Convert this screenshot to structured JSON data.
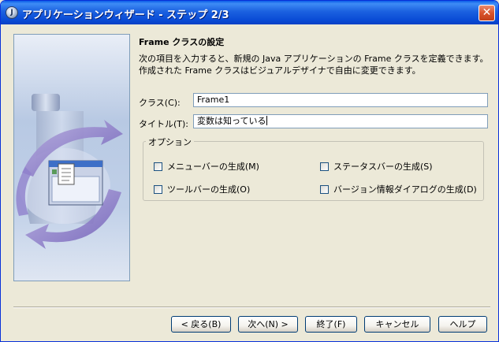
{
  "window": {
    "title": "アプリケーションウィザード - ステップ 2/3",
    "close": "✕",
    "app_icon_label": "J"
  },
  "content": {
    "heading": "Frame クラスの設定",
    "desc_line1": "次の項目を入力すると、新規の Java アプリケーションの Frame クラスを定義できます。",
    "desc_line2": "作成された Frame クラスはビジュアルデザイナで自由に変更できます。"
  },
  "fields": {
    "class_label": "クラス(C):",
    "class_value": "Frame1",
    "title_label": "タイトル(T):",
    "title_value": "変数は知っている"
  },
  "options": {
    "title": "オプション",
    "menubar": "メニューバーの生成(M)",
    "statusbar": "ステータスバーの生成(S)",
    "toolbar": "ツールバーの生成(O)",
    "version": "バージョン情報ダイアログの生成(D)"
  },
  "buttons": {
    "back": "< 戻る(B)",
    "next": "次へ(N) >",
    "finish": "終了(F)",
    "cancel": "キャンセル",
    "help": "ヘルプ"
  },
  "colors": {
    "titlebar": "#0a4cd6",
    "dialog_bg": "#ece9d8",
    "close_button": "#d9532c",
    "field_border": "#7f9db9"
  },
  "icons": {
    "app": "java-app-icon",
    "close": "close-icon",
    "illustration": "wizard-flask-arrows-illustration"
  }
}
